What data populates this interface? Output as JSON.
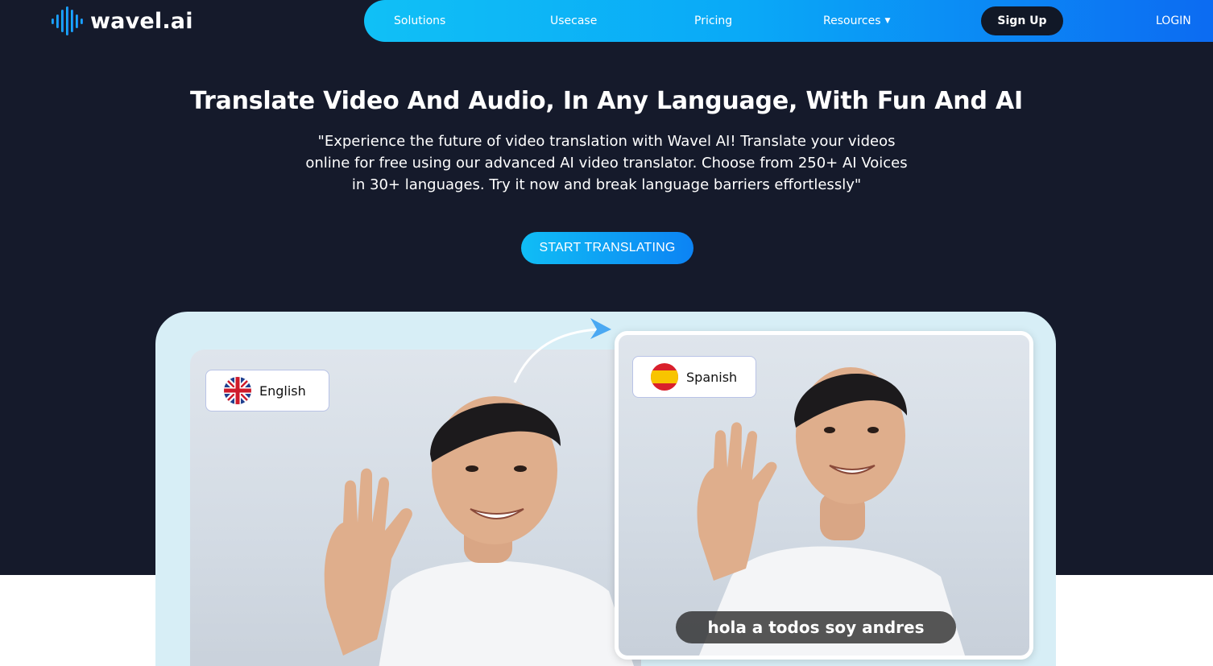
{
  "header": {
    "logo_text": "wavel.ai",
    "logo_icon": "sound-wave-icon",
    "nav": {
      "solutions": "Solutions",
      "usecase": "Usecase",
      "pricing": "Pricing",
      "resources": "Resources",
      "signup": "Sign Up",
      "login": "LOGIN"
    }
  },
  "hero": {
    "title": "Translate Video And Audio, In Any Language, With Fun And AI",
    "description": "\"Experience the future of video translation with Wavel AI! Translate your videos online for free using our advanced AI video translator. Choose from 250+ AI Voices in 30+ languages. Try it now and break language barriers effortlessly\"",
    "cta": "START TRANSLATING"
  },
  "demo": {
    "source_language": "English",
    "target_language": "Spanish",
    "subtitle": "hola a todos soy andres",
    "source_flag_icon": "uk-flag-icon",
    "target_flag_icon": "spain-flag-icon"
  },
  "colors": {
    "hero_bg": "#151a2b",
    "nav_gradient_start": "#10c0f6",
    "nav_gradient_end": "#0c6bf2",
    "signup_bg": "#111827",
    "demo_card_bg": "#d7eef6"
  }
}
